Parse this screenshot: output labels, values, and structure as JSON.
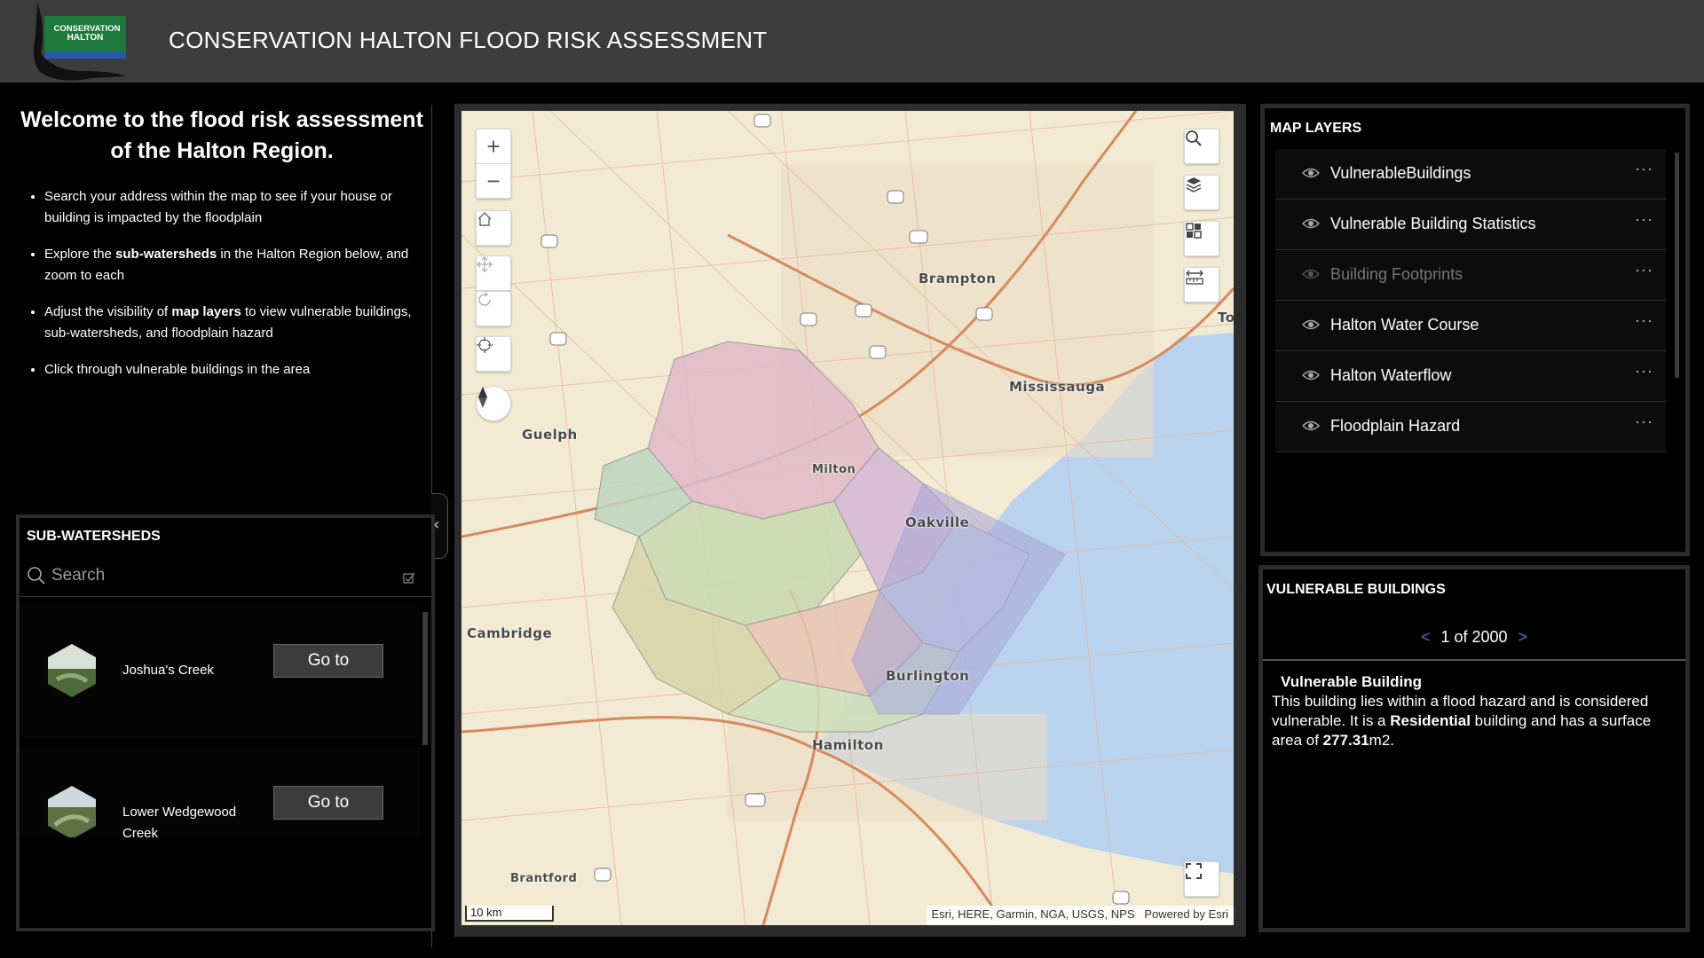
{
  "header": {
    "logo_text_line1": "CONSERVATION",
    "logo_text_line2": "HALTON",
    "title": "CONSERVATION HALTON FLOOD RISK ASSESSMENT"
  },
  "intro": {
    "heading": "Welcome to the flood risk assessment of the Halton Region.",
    "bullets": [
      {
        "before": "Search your address within the map to see if your house or building is impacted by the floodplain",
        "bold": "",
        "after": ""
      },
      {
        "before": "Explore the ",
        "bold": "sub-watersheds",
        "after": " in the Halton Region below, and zoom to each"
      },
      {
        "before": "Adjust the visibility of ",
        "bold": "map layers",
        "after": " to view vulnerable buildings, sub-watersheds, and floodplain hazard"
      },
      {
        "before": "Click through vulnerable buildings in the area",
        "bold": "",
        "after": ""
      }
    ]
  },
  "subwatersheds": {
    "title": "SUB-WATERSHEDS",
    "search_placeholder": "Search",
    "items": [
      {
        "name": "Joshua's Creek",
        "button": "Go to"
      },
      {
        "name": "Lower Wedgewood Creek",
        "button": "Go to"
      }
    ]
  },
  "map": {
    "cities": [
      "Brampton",
      "Mississauga",
      "Guelph",
      "Milton",
      "Oakville",
      "Cambridge",
      "Burlington",
      "Hamilton",
      "Brantford",
      "To"
    ],
    "scale": "10 km",
    "attribution": "Esri, HERE, Garmin, NGA, USGS, NPS",
    "powered_by": "Powered by Esri",
    "controls": [
      "zoom-in-icon",
      "zoom-out-icon",
      "home-icon",
      "pan-icon",
      "rotate-icon",
      "locate-icon",
      "compass-icon",
      "search-icon",
      "layers-icon",
      "basemap-gallery-icon",
      "measure-icon",
      "fullscreen-icon"
    ]
  },
  "layers": {
    "title": "MAP LAYERS",
    "items": [
      {
        "name": "VulnerableBuildings",
        "visible": true
      },
      {
        "name": "Vulnerable Building Statistics",
        "visible": true
      },
      {
        "name": "Building Footprints",
        "visible": false
      },
      {
        "name": "Halton Water Course",
        "visible": true
      },
      {
        "name": "Halton Waterflow",
        "visible": true
      },
      {
        "name": "Floodplain Hazard",
        "visible": true
      }
    ],
    "more": "···"
  },
  "vulnerable": {
    "title": "VULNERABLE BUILDINGS",
    "pager": "1 of 2000",
    "prev": "<",
    "next": ">",
    "popup_title": "Vulnerable Building",
    "text_1": "This building lies within a flood hazard and is considered vulnerable. It is a ",
    "type": "Residential",
    "text_2": " building and has a surface area of ",
    "area": "277.31",
    "unit": "m2."
  },
  "colors": {
    "header_bg": "#3c3c3c",
    "panel_border": "#2b2b2b",
    "accent_blue": "#3a7bd5",
    "logo_green": "#1e7a3c",
    "water": "#b9d3ee"
  }
}
